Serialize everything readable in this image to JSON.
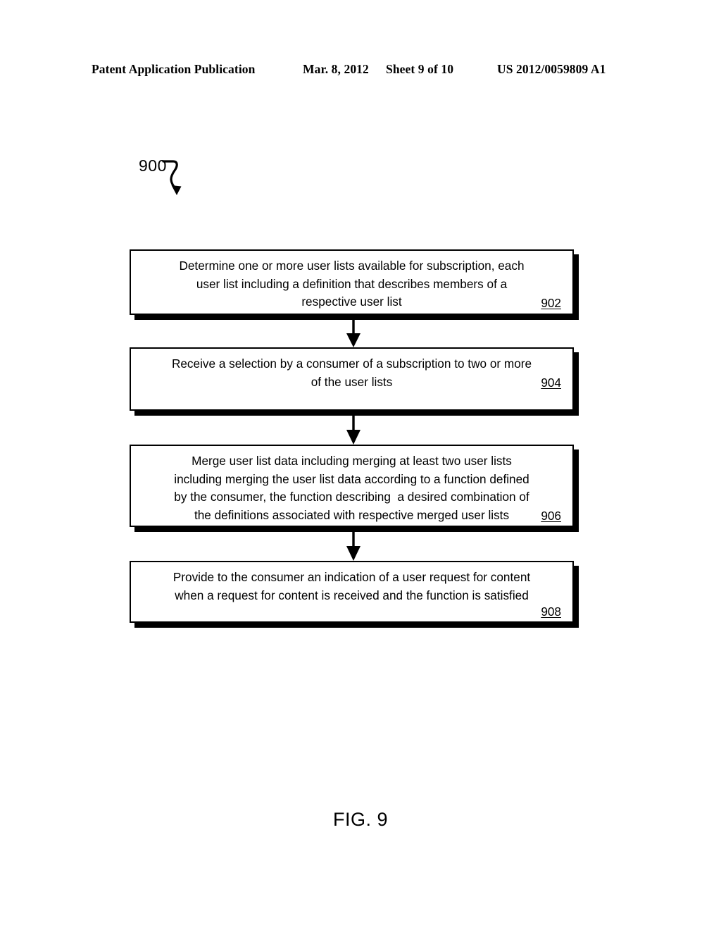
{
  "header": {
    "publication": "Patent Application Publication",
    "date": "Mar. 8, 2012",
    "sheet": "Sheet 9 of 10",
    "doc_number": "US 2012/0059809 A1"
  },
  "figure": {
    "reference_label": "900",
    "caption": "FIG. 9"
  },
  "flowchart": {
    "steps": [
      {
        "id": "902",
        "text": "Determine one or more user lists available for subscription, each\nuser list including a definition that describes members of a\nrespective user list",
        "number": "902"
      },
      {
        "id": "904",
        "text": "Receive a selection by a consumer of a subscription to two or more\nof the user lists",
        "number": "904"
      },
      {
        "id": "906",
        "text": "Merge user list data including merging at least two user lists\nincluding merging the user list data according to a function defined\nby the consumer, the function describing  a desired combination of\nthe definitions associated with respective merged user lists",
        "number": "906"
      },
      {
        "id": "908",
        "text": "Provide to the consumer an indication of a user request for content\nwhen a request for content is received and the function is satisfied",
        "number": "908"
      }
    ]
  },
  "colors": {
    "ink": "#000000",
    "paper": "#ffffff"
  }
}
